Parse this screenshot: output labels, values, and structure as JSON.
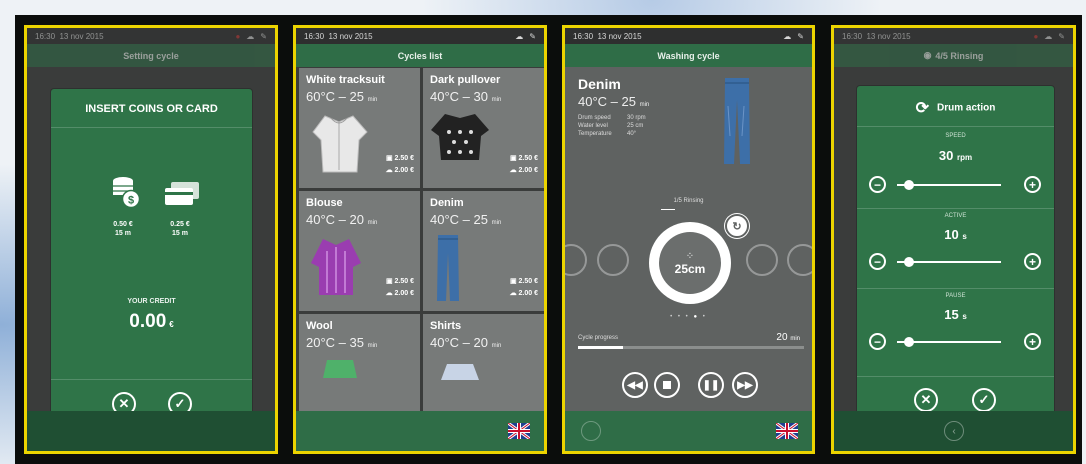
{
  "panel1": {
    "status": {
      "time": "16:30",
      "date": "13 nov 2015"
    },
    "title": "Setting cycle",
    "dialog_title": "INSERT COINS OR CARD",
    "coin": {
      "price": "0.50 €",
      "duration": "15 m"
    },
    "card": {
      "price": "0.25 €",
      "duration": "15 m"
    },
    "credit_label": "YOUR CREDIT",
    "credit_value": "0.00",
    "credit_unit": "€"
  },
  "panel2": {
    "status": {
      "time": "16:30",
      "date": "13 nov 2015"
    },
    "title": "Cycles list",
    "cycles": [
      {
        "name": "White tracksuit",
        "temp": "60°C",
        "time": "25",
        "unit": "min",
        "price1": "2.50 €",
        "price2": "2.00 €"
      },
      {
        "name": "Dark pullover",
        "temp": "40°C",
        "time": "30",
        "unit": "min",
        "price1": "2.50 €",
        "price2": "2.00 €"
      },
      {
        "name": "Blouse",
        "temp": "40°C",
        "time": "20",
        "unit": "min",
        "price1": "2.50 €",
        "price2": "2.00 €"
      },
      {
        "name": "Denim",
        "temp": "40°C",
        "time": "25",
        "unit": "min",
        "price1": "2.50 €",
        "price2": "2.00 €"
      },
      {
        "name": "Wool",
        "temp": "20°C",
        "time": "35",
        "unit": "min"
      },
      {
        "name": "Shirts",
        "temp": "40°C",
        "time": "20",
        "unit": "min"
      }
    ]
  },
  "panel3": {
    "status": {
      "time": "16:30",
      "date": "13 nov 2015"
    },
    "title": "Washing cycle",
    "cycle_name": "Denim",
    "cycle_spec": "40°C – 25",
    "cycle_spec_unit": "min",
    "info_labels": [
      "Drum speed",
      "Water level",
      "Temperature"
    ],
    "info_values": [
      "30 rpm",
      "25 cm",
      "40°"
    ],
    "phase": "1/5 Rinsing",
    "water_level": "25cm",
    "progress_label": "Cycle progress",
    "progress_value": "20",
    "progress_unit": "min",
    "progress_fraction": 0.2
  },
  "panel4": {
    "status": {
      "time": "16:30",
      "date": "13 nov 2015"
    },
    "title": "4/5 Rinsing",
    "dialog_title": "Drum action",
    "sections": [
      {
        "label": "SPEED",
        "value": "30",
        "unit": "rpm",
        "fraction": 0.12
      },
      {
        "label": "ACTIVE",
        "value": "10",
        "unit": "s",
        "fraction": 0.12
      },
      {
        "label": "PAUSE",
        "value": "15",
        "unit": "s",
        "fraction": 0.12
      }
    ]
  },
  "colors": {
    "frame": "#ecd400",
    "green": "#2f7448",
    "bar": "#1f4f33"
  }
}
